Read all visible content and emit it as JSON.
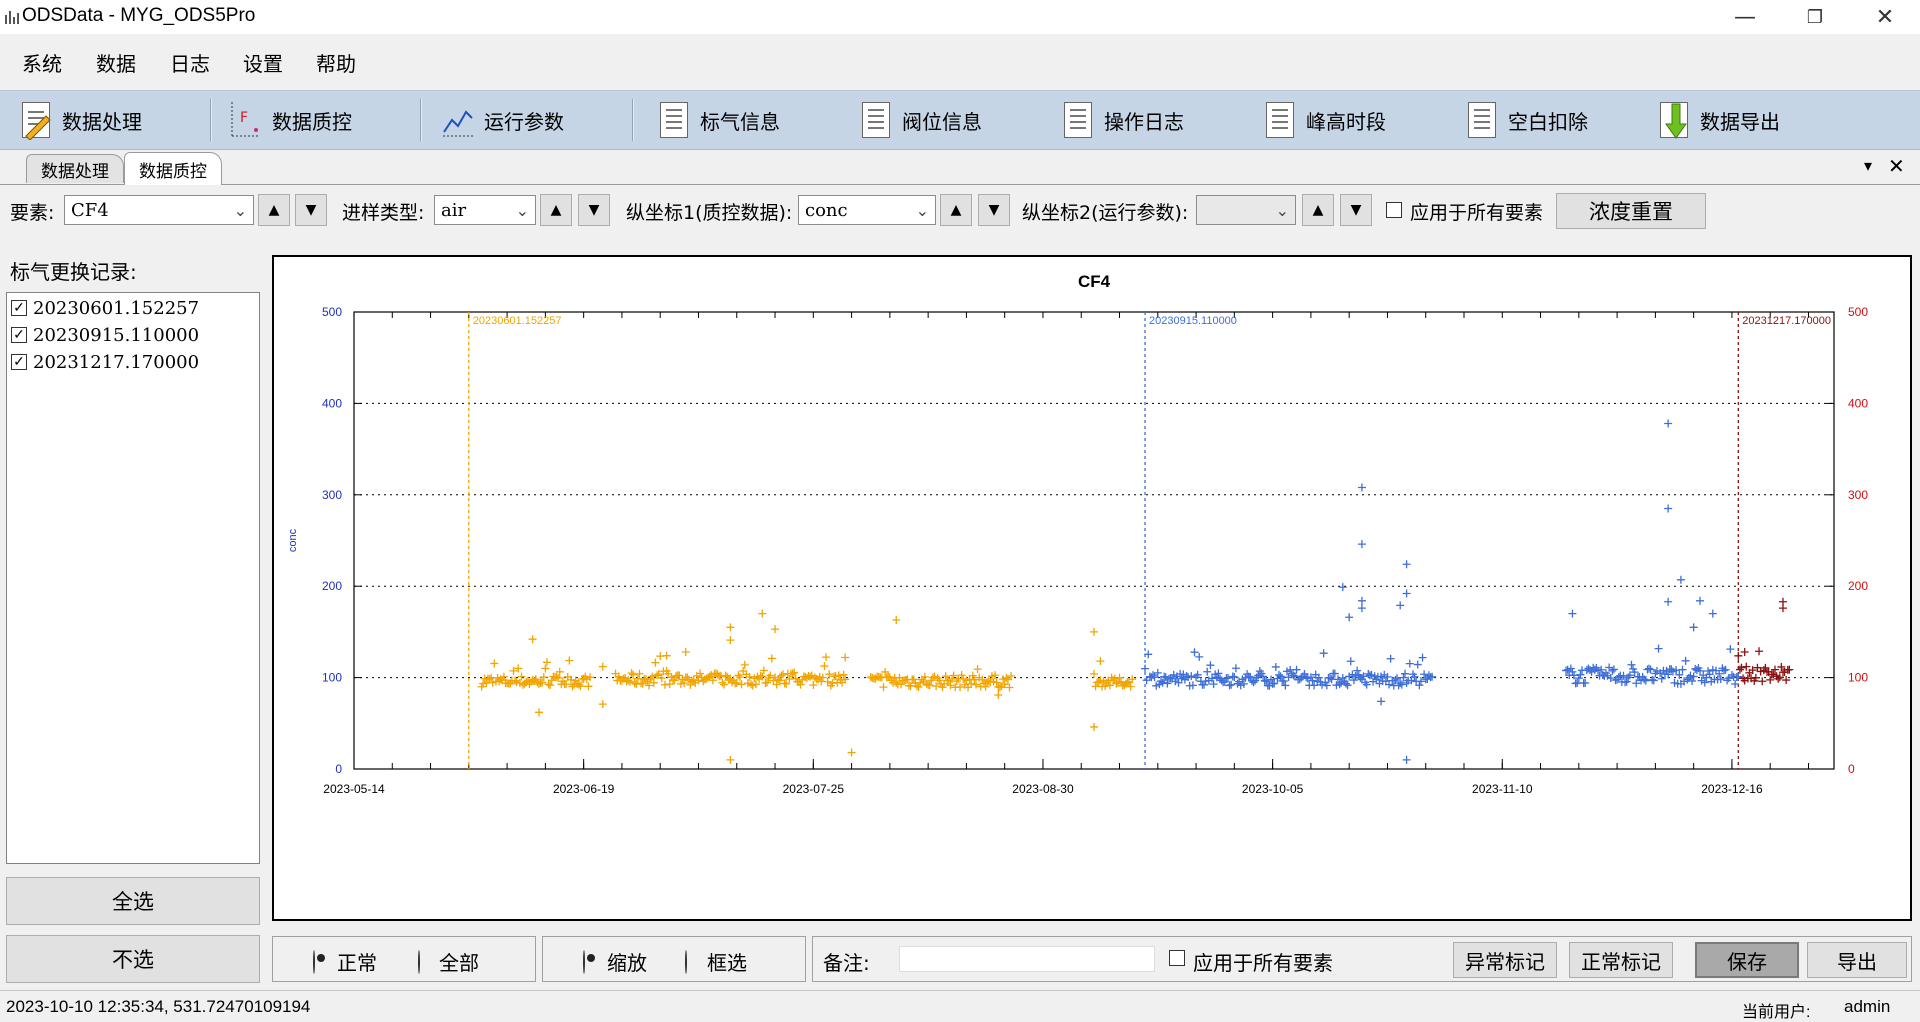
{
  "window": {
    "title": "ODSData - MYG_ODS5Pro",
    "minimize": "—",
    "maximize": "❐",
    "close": "✕"
  },
  "menu": [
    "系统",
    "数据",
    "日志",
    "设置",
    "帮助"
  ],
  "toolbar": [
    "数据处理",
    "数据质控",
    "运行参数",
    "标气信息",
    "阀位信息",
    "操作日志",
    "峰高时段",
    "空白扣除",
    "数据导出"
  ],
  "tabs": [
    "数据处理",
    "数据质控"
  ],
  "tabstrip": {
    "menu_glyph": "▾",
    "close_glyph": "✕"
  },
  "controls": {
    "element_label": "要素:",
    "element_value": "CF4",
    "sample_label": "进样类型:",
    "sample_value": "air",
    "y1_label": "纵坐标1(质控数据):",
    "y1_value": "conc",
    "y2_label": "纵坐标2(运行参数):",
    "y2_value": "",
    "apply_all": "应用于所有要素",
    "reset_button": "浓度重置",
    "up": "▲",
    "down": "▼"
  },
  "left_panel": {
    "title": "标气更换记录:",
    "records": [
      "20230601.152257",
      "20230915.110000",
      "20231217.170000"
    ],
    "select_all": "全选",
    "select_none": "不选"
  },
  "chart_data": {
    "type": "scatter",
    "title": "CF4",
    "ylabel": "conc",
    "y2_ticks_shown": true,
    "xlim": [
      "2023-05-14",
      "2024-01-01"
    ],
    "ylim": [
      0,
      500
    ],
    "y_ticks": [
      0,
      100,
      200,
      300,
      400,
      500
    ],
    "x_tick_labels": [
      "2023-05-14",
      "2023-06-19",
      "2023-07-25",
      "2023-08-30",
      "2023-10-05",
      "2023-11-10",
      "2023-12-16"
    ],
    "grid": "horizontal-dotted",
    "marker": "+",
    "standard_changes": [
      {
        "label": "20230601.152257",
        "date": "2023-06-01",
        "color": "#f2a400"
      },
      {
        "label": "20230915.110000",
        "date": "2023-09-15",
        "color": "#3e6fd8"
      },
      {
        "label": "20231217.170000",
        "date": "2023-12-17",
        "color": "#8b1010"
      }
    ],
    "series": [
      {
        "color": "#f2a400",
        "ranges": [
          {
            "from": "2023-06-03",
            "to": "2023-06-20",
            "base": 96,
            "spread": 6
          },
          {
            "from": "2023-06-24",
            "to": "2023-07-30",
            "base": 98,
            "spread": 7
          },
          {
            "from": "2023-08-03",
            "to": "2023-08-25",
            "base": 96,
            "spread": 7
          },
          {
            "from": "2023-09-07",
            "to": "2023-09-13",
            "base": 95,
            "spread": 5
          }
        ],
        "outliers": [
          [
            "2023-06-11",
            142
          ],
          [
            "2023-06-12",
            62
          ],
          [
            "2023-06-22",
            112
          ],
          [
            "2023-06-22",
            71
          ],
          [
            "2023-07-02",
            124
          ],
          [
            "2023-07-05",
            128
          ],
          [
            "2023-07-12",
            155
          ],
          [
            "2023-07-12",
            141
          ],
          [
            "2023-07-12",
            10
          ],
          [
            "2023-07-17",
            170
          ],
          [
            "2023-07-19",
            153
          ],
          [
            "2023-07-30",
            122
          ],
          [
            "2023-07-31",
            18
          ],
          [
            "2023-08-07",
            163
          ],
          [
            "2023-08-23",
            81
          ],
          [
            "2023-09-07",
            150
          ],
          [
            "2023-09-07",
            46
          ],
          [
            "2023-09-08",
            118
          ]
        ]
      },
      {
        "color": "#3e6fd8",
        "ranges": [
          {
            "from": "2023-09-15",
            "to": "2023-10-30",
            "base": 98,
            "spread": 7
          },
          {
            "from": "2023-11-20",
            "to": "2023-12-17",
            "base": 102,
            "spread": 9
          }
        ],
        "outliers": [
          [
            "2023-10-16",
            199
          ],
          [
            "2023-10-17",
            166
          ],
          [
            "2023-10-19",
            184
          ],
          [
            "2023-10-19",
            176
          ],
          [
            "2023-10-19",
            308
          ],
          [
            "2023-10-19",
            246
          ],
          [
            "2023-10-22",
            74
          ],
          [
            "2023-10-26",
            224
          ],
          [
            "2023-10-26",
            192
          ],
          [
            "2023-10-25",
            179
          ],
          [
            "2023-10-26",
            10
          ],
          [
            "2023-11-21",
            170
          ],
          [
            "2023-12-06",
            378
          ],
          [
            "2023-12-06",
            285
          ],
          [
            "2023-12-06",
            183
          ],
          [
            "2023-12-08",
            207
          ],
          [
            "2023-12-11",
            184
          ],
          [
            "2023-12-13",
            170
          ],
          [
            "2023-12-10",
            155
          ]
        ]
      },
      {
        "color": "#8b1010",
        "ranges": [
          {
            "from": "2023-12-17",
            "to": "2023-12-25",
            "base": 104,
            "spread": 8
          }
        ],
        "outliers": [
          [
            "2023-12-24",
            183
          ],
          [
            "2023-12-24",
            176
          ],
          [
            "2023-12-18",
            128
          ]
        ]
      }
    ]
  },
  "bottom": {
    "mode_normal": "正常",
    "mode_all": "全部",
    "zoom": "缩放",
    "box_select": "框选",
    "remark_label": "备注:",
    "remark_value": "",
    "apply_all": "应用于所有要素",
    "abnormal_mark": "异常标记",
    "normal_mark": "正常标记",
    "save": "保存",
    "export": "导出"
  },
  "status": {
    "left": "2023-10-10 12:35:34, 531.72470109194",
    "user_label": "当前用户:",
    "user": "admin"
  }
}
